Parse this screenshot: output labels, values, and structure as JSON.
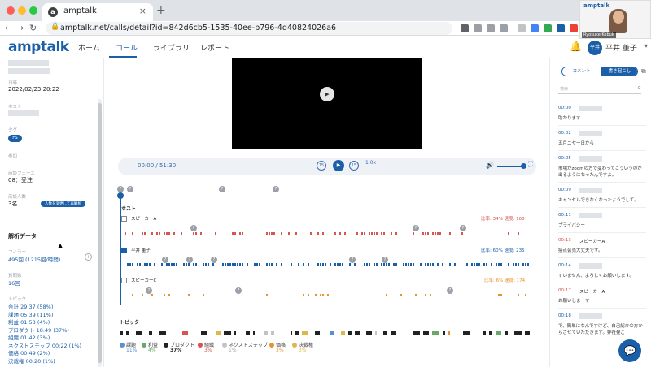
{
  "browser": {
    "tab_title": "amptalk",
    "favicon": "a",
    "url": "amptalk.net/calls/detail?id=842d6cb5-1535-40ee-b796-4d40824026a6",
    "traffic_colors": [
      "#ff5f57",
      "#febc2e",
      "#28c840"
    ]
  },
  "app": {
    "logo": "amptalk",
    "nav": [
      "ホーム",
      "コール",
      "ライブラリ",
      "レポート"
    ],
    "avatar_initials": "平井",
    "user_name": "平井 董子",
    "accent": "#1b5fa8"
  },
  "meeting_thumb": {
    "logo": "amptalk",
    "name": "Ryosuke Kobuk"
  },
  "left": {
    "date_label": "日時",
    "date": "2022/02/23 20:22",
    "host_label": "ホスト",
    "tag_label": "タグ",
    "tag": "FS",
    "participants_label": "参加",
    "phase_label": "商談フェーズ",
    "phase": "08：受注",
    "count_label": "商談人数",
    "count": "3名",
    "count_button": "人数を変更して再解析",
    "analysis_title": "解析データ",
    "filler_label": "フィラー",
    "filler": "495回 (1215回/時間)",
    "questions_label": "質問数",
    "questions": "16回",
    "topics_label": "トピック",
    "topics": [
      "合計 29:37 (58%)",
      "課題 05:39 (11%)",
      "利益 01:53 (4%)",
      "プロダクト 18:49 (37%)",
      "組織 01:42 (3%)",
      "ネクストステップ 00:22 (1%)",
      "価格 00:49 (2%)",
      "決裁権 00:20 (1%)"
    ]
  },
  "player": {
    "time": "00:00 / 51:30",
    "rewind": "15",
    "forward": "15",
    "speed": "1.0x"
  },
  "timeline": {
    "host_label": "ホスト",
    "speakers": [
      {
        "name": "スピーカーA",
        "stats": "比率: 34%   速度: 168",
        "color": "#d9534f",
        "checked": false
      },
      {
        "name": "平井 董子",
        "stats": "比率: 60%   速度: 235",
        "color": "#1b5fa8",
        "checked": true
      },
      {
        "name": "スピーカーC",
        "stats": "比率: 6%   速度: 174",
        "color": "#e8922d",
        "checked": false
      }
    ]
  },
  "topics": {
    "title": "トピック",
    "legend": [
      {
        "name": "課題",
        "pct": "11%",
        "color": "#5b8fd4"
      },
      {
        "name": "利益",
        "pct": "4%",
        "color": "#6aa86a"
      },
      {
        "name": "プロダクト",
        "pct": "37%",
        "color": "#222222"
      },
      {
        "name": "組織",
        "pct": "3%",
        "color": "#d9534f"
      },
      {
        "name": "ネクストステップ",
        "pct": "1%",
        "color": "#c0c4c9"
      },
      {
        "name": "価格",
        "pct": "3%",
        "color": "#e8922d"
      },
      {
        "name": "決裁権",
        "pct": "3%",
        "color": "#e0b84a"
      }
    ]
  },
  "right": {
    "tab_comment": "コメント",
    "tab_transcript": "書き起こし",
    "search_placeholder": "検索",
    "entries": [
      {
        "ts": "00:00",
        "text": "助かります",
        "speaker": ""
      },
      {
        "ts": "00:02",
        "text": "五月ニヤー日から",
        "speaker": ""
      },
      {
        "ts": "00:05",
        "text": "市場がzoomの方で変わってこういうのが出るようになったんですよ。",
        "speaker": ""
      },
      {
        "ts": "00:09",
        "text": "キャンセルできなくなったようでして。",
        "speaker": ""
      },
      {
        "ts": "00:11",
        "text": "プライバシー",
        "speaker": ""
      },
      {
        "ts": "00:13",
        "text": "接点会売大丈夫です。",
        "speaker": "スピーカーA"
      },
      {
        "ts": "00:14",
        "text": "すいません、よろしくお願いします。",
        "speaker": ""
      },
      {
        "ts": "00:17",
        "text": "お願いしまーす",
        "speaker": "スピーカーA"
      },
      {
        "ts": "00:18",
        "text": "で、簡単になんですけど、自己紹介の方からさせていただきます。弊社発ご",
        "speaker": ""
      }
    ]
  }
}
